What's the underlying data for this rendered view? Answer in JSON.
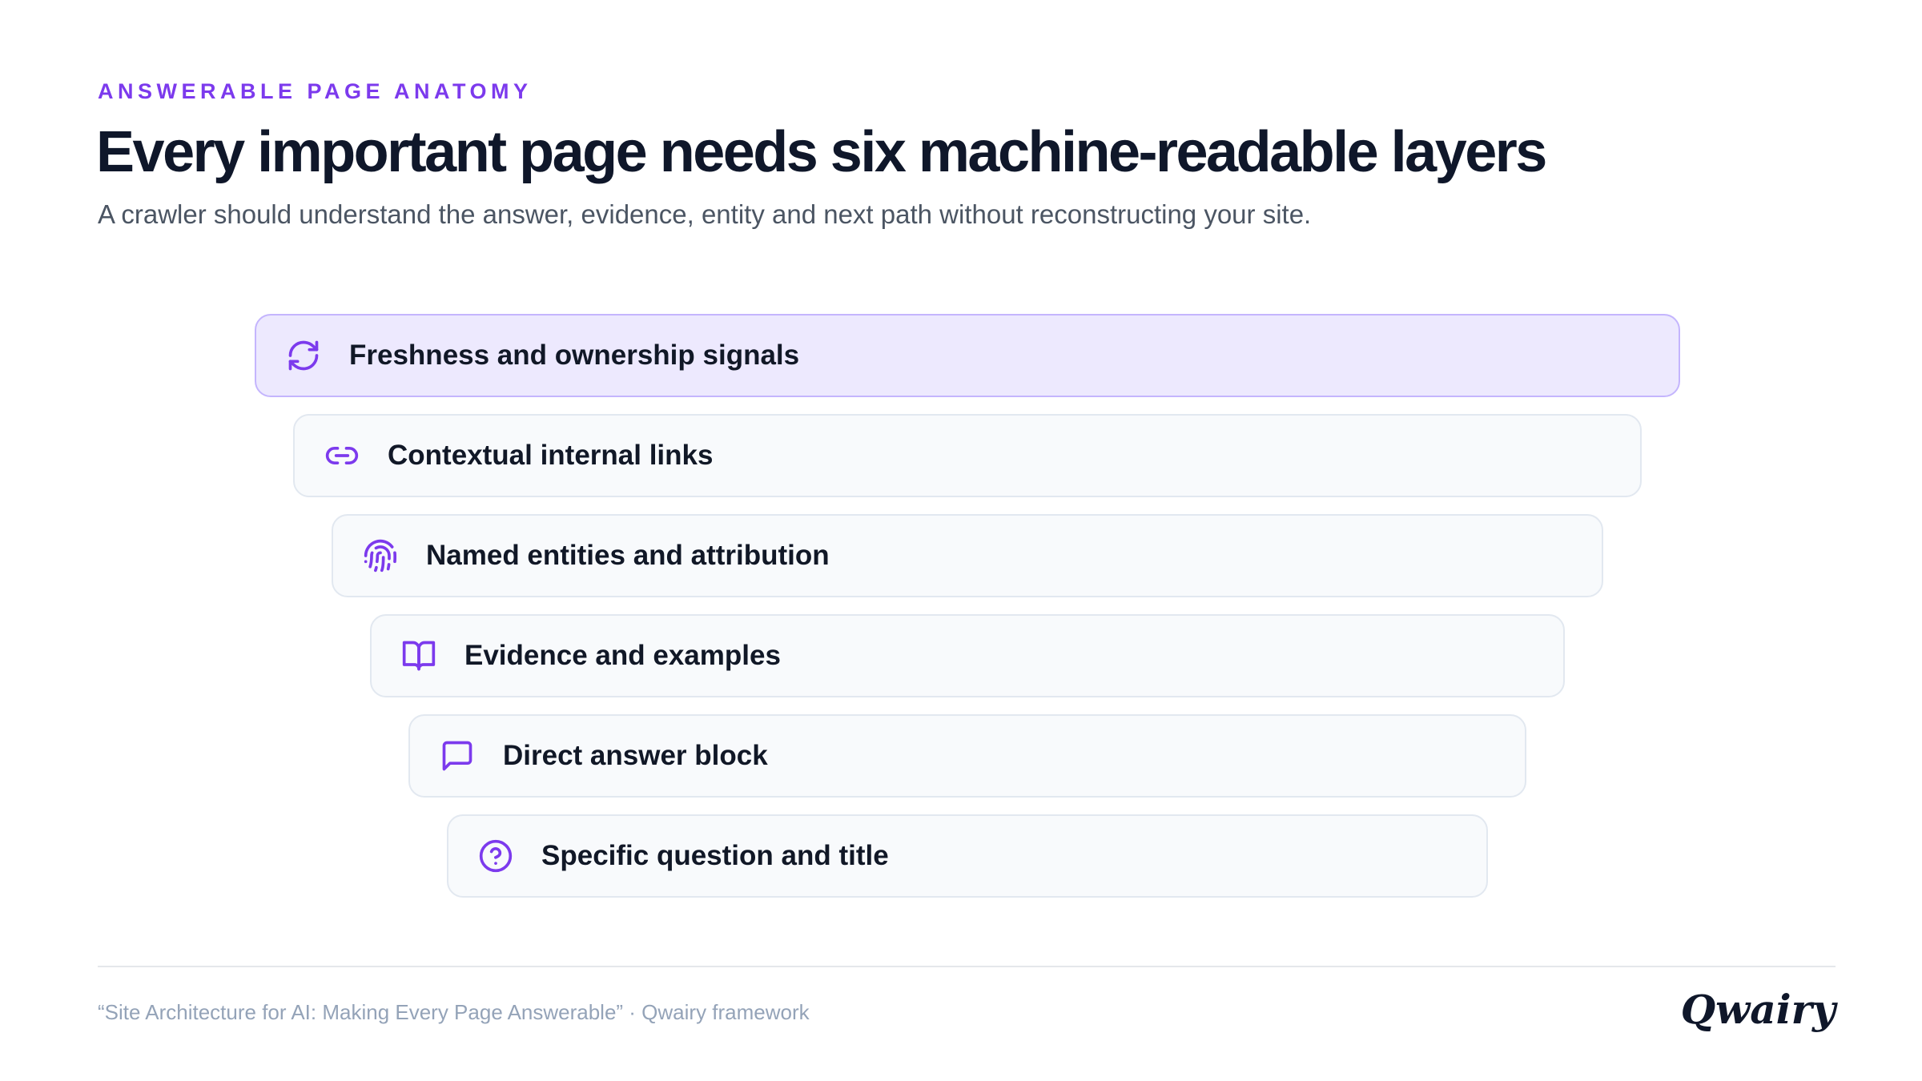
{
  "header": {
    "eyebrow": "ANSWERABLE PAGE ANATOMY",
    "title": "Every important page needs six machine-readable layers",
    "subtitle": "A crawler should understand the answer, evidence, entity and next path without reconstructing your site."
  },
  "layers": [
    {
      "label": "Freshness and ownership signals",
      "icon": "refresh-icon",
      "highlighted": true
    },
    {
      "label": "Contextual internal links",
      "icon": "link-icon",
      "highlighted": false
    },
    {
      "label": "Named entities and attribution",
      "icon": "fingerprint-icon",
      "highlighted": false
    },
    {
      "label": "Evidence and examples",
      "icon": "open-book-icon",
      "highlighted": false
    },
    {
      "label": "Direct answer block",
      "icon": "message-square-icon",
      "highlighted": false
    },
    {
      "label": "Specific question and title",
      "icon": "help-circle-icon",
      "highlighted": false
    }
  ],
  "footer": {
    "note": "“Site Architecture for AI: Making Every Page Answerable” · Qwairy framework",
    "logo": "Qwairy"
  },
  "colors": {
    "accent": "#7c3aed",
    "highlight_bg": "#ede9fe",
    "highlight_border": "#c4b5fd",
    "card_bg": "#f8fafc",
    "card_border": "#e2e8f0",
    "title": "#0f172a"
  }
}
